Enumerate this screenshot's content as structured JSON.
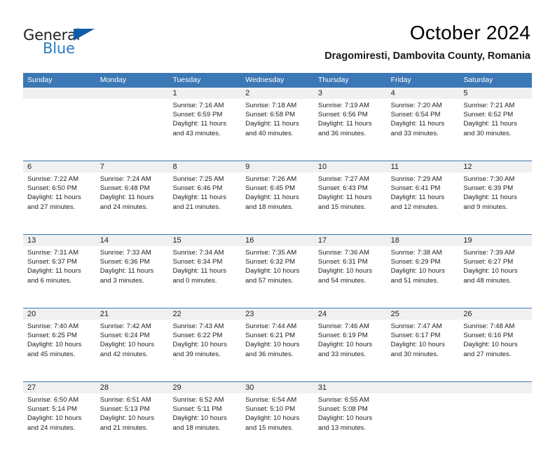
{
  "logo": {
    "word_top": "General",
    "word_bottom": "Blue",
    "triangle_color": "#0e5ca8",
    "blue_color": "#2b7cc3"
  },
  "header": {
    "title": "October 2024",
    "subtitle": "Dragomiresti, Dambovita County, Romania"
  },
  "theme": {
    "header_blue": "#3b78b5",
    "day_band_gray": "#f0f0f0",
    "text_color": "#222222"
  },
  "weekdays": [
    "Sunday",
    "Monday",
    "Tuesday",
    "Wednesday",
    "Thursday",
    "Friday",
    "Saturday"
  ],
  "weeks": [
    {
      "days": [
        {
          "number": "",
          "sunrise": "",
          "sunset": "",
          "daylight": "",
          "empty": true
        },
        {
          "number": "",
          "sunrise": "",
          "sunset": "",
          "daylight": "",
          "empty": true
        },
        {
          "number": "1",
          "sunrise": "Sunrise: 7:16 AM",
          "sunset": "Sunset: 6:59 PM",
          "daylight": "Daylight: 11 hours and 43 minutes.",
          "empty": false
        },
        {
          "number": "2",
          "sunrise": "Sunrise: 7:18 AM",
          "sunset": "Sunset: 6:58 PM",
          "daylight": "Daylight: 11 hours and 40 minutes.",
          "empty": false
        },
        {
          "number": "3",
          "sunrise": "Sunrise: 7:19 AM",
          "sunset": "Sunset: 6:56 PM",
          "daylight": "Daylight: 11 hours and 36 minutes.",
          "empty": false
        },
        {
          "number": "4",
          "sunrise": "Sunrise: 7:20 AM",
          "sunset": "Sunset: 6:54 PM",
          "daylight": "Daylight: 11 hours and 33 minutes.",
          "empty": false
        },
        {
          "number": "5",
          "sunrise": "Sunrise: 7:21 AM",
          "sunset": "Sunset: 6:52 PM",
          "daylight": "Daylight: 11 hours and 30 minutes.",
          "empty": false
        }
      ]
    },
    {
      "days": [
        {
          "number": "6",
          "sunrise": "Sunrise: 7:22 AM",
          "sunset": "Sunset: 6:50 PM",
          "daylight": "Daylight: 11 hours and 27 minutes.",
          "empty": false
        },
        {
          "number": "7",
          "sunrise": "Sunrise: 7:24 AM",
          "sunset": "Sunset: 6:48 PM",
          "daylight": "Daylight: 11 hours and 24 minutes.",
          "empty": false
        },
        {
          "number": "8",
          "sunrise": "Sunrise: 7:25 AM",
          "sunset": "Sunset: 6:46 PM",
          "daylight": "Daylight: 11 hours and 21 minutes.",
          "empty": false
        },
        {
          "number": "9",
          "sunrise": "Sunrise: 7:26 AM",
          "sunset": "Sunset: 6:45 PM",
          "daylight": "Daylight: 11 hours and 18 minutes.",
          "empty": false
        },
        {
          "number": "10",
          "sunrise": "Sunrise: 7:27 AM",
          "sunset": "Sunset: 6:43 PM",
          "daylight": "Daylight: 11 hours and 15 minutes.",
          "empty": false
        },
        {
          "number": "11",
          "sunrise": "Sunrise: 7:29 AM",
          "sunset": "Sunset: 6:41 PM",
          "daylight": "Daylight: 11 hours and 12 minutes.",
          "empty": false
        },
        {
          "number": "12",
          "sunrise": "Sunrise: 7:30 AM",
          "sunset": "Sunset: 6:39 PM",
          "daylight": "Daylight: 11 hours and 9 minutes.",
          "empty": false
        }
      ]
    },
    {
      "days": [
        {
          "number": "13",
          "sunrise": "Sunrise: 7:31 AM",
          "sunset": "Sunset: 6:37 PM",
          "daylight": "Daylight: 11 hours and 6 minutes.",
          "empty": false
        },
        {
          "number": "14",
          "sunrise": "Sunrise: 7:33 AM",
          "sunset": "Sunset: 6:36 PM",
          "daylight": "Daylight: 11 hours and 3 minutes.",
          "empty": false
        },
        {
          "number": "15",
          "sunrise": "Sunrise: 7:34 AM",
          "sunset": "Sunset: 6:34 PM",
          "daylight": "Daylight: 11 hours and 0 minutes.",
          "empty": false
        },
        {
          "number": "16",
          "sunrise": "Sunrise: 7:35 AM",
          "sunset": "Sunset: 6:32 PM",
          "daylight": "Daylight: 10 hours and 57 minutes.",
          "empty": false
        },
        {
          "number": "17",
          "sunrise": "Sunrise: 7:36 AM",
          "sunset": "Sunset: 6:31 PM",
          "daylight": "Daylight: 10 hours and 54 minutes.",
          "empty": false
        },
        {
          "number": "18",
          "sunrise": "Sunrise: 7:38 AM",
          "sunset": "Sunset: 6:29 PM",
          "daylight": "Daylight: 10 hours and 51 minutes.",
          "empty": false
        },
        {
          "number": "19",
          "sunrise": "Sunrise: 7:39 AM",
          "sunset": "Sunset: 6:27 PM",
          "daylight": "Daylight: 10 hours and 48 minutes.",
          "empty": false
        }
      ]
    },
    {
      "days": [
        {
          "number": "20",
          "sunrise": "Sunrise: 7:40 AM",
          "sunset": "Sunset: 6:25 PM",
          "daylight": "Daylight: 10 hours and 45 minutes.",
          "empty": false
        },
        {
          "number": "21",
          "sunrise": "Sunrise: 7:42 AM",
          "sunset": "Sunset: 6:24 PM",
          "daylight": "Daylight: 10 hours and 42 minutes.",
          "empty": false
        },
        {
          "number": "22",
          "sunrise": "Sunrise: 7:43 AM",
          "sunset": "Sunset: 6:22 PM",
          "daylight": "Daylight: 10 hours and 39 minutes.",
          "empty": false
        },
        {
          "number": "23",
          "sunrise": "Sunrise: 7:44 AM",
          "sunset": "Sunset: 6:21 PM",
          "daylight": "Daylight: 10 hours and 36 minutes.",
          "empty": false
        },
        {
          "number": "24",
          "sunrise": "Sunrise: 7:46 AM",
          "sunset": "Sunset: 6:19 PM",
          "daylight": "Daylight: 10 hours and 33 minutes.",
          "empty": false
        },
        {
          "number": "25",
          "sunrise": "Sunrise: 7:47 AM",
          "sunset": "Sunset: 6:17 PM",
          "daylight": "Daylight: 10 hours and 30 minutes.",
          "empty": false
        },
        {
          "number": "26",
          "sunrise": "Sunrise: 7:48 AM",
          "sunset": "Sunset: 6:16 PM",
          "daylight": "Daylight: 10 hours and 27 minutes.",
          "empty": false
        }
      ]
    },
    {
      "days": [
        {
          "number": "27",
          "sunrise": "Sunrise: 6:50 AM",
          "sunset": "Sunset: 5:14 PM",
          "daylight": "Daylight: 10 hours and 24 minutes.",
          "empty": false
        },
        {
          "number": "28",
          "sunrise": "Sunrise: 6:51 AM",
          "sunset": "Sunset: 5:13 PM",
          "daylight": "Daylight: 10 hours and 21 minutes.",
          "empty": false
        },
        {
          "number": "29",
          "sunrise": "Sunrise: 6:52 AM",
          "sunset": "Sunset: 5:11 PM",
          "daylight": "Daylight: 10 hours and 18 minutes.",
          "empty": false
        },
        {
          "number": "30",
          "sunrise": "Sunrise: 6:54 AM",
          "sunset": "Sunset: 5:10 PM",
          "daylight": "Daylight: 10 hours and 15 minutes.",
          "empty": false
        },
        {
          "number": "31",
          "sunrise": "Sunrise: 6:55 AM",
          "sunset": "Sunset: 5:08 PM",
          "daylight": "Daylight: 10 hours and 13 minutes.",
          "empty": false
        },
        {
          "number": "",
          "sunrise": "",
          "sunset": "",
          "daylight": "",
          "empty": true
        },
        {
          "number": "",
          "sunrise": "",
          "sunset": "",
          "daylight": "",
          "empty": true
        }
      ]
    }
  ]
}
